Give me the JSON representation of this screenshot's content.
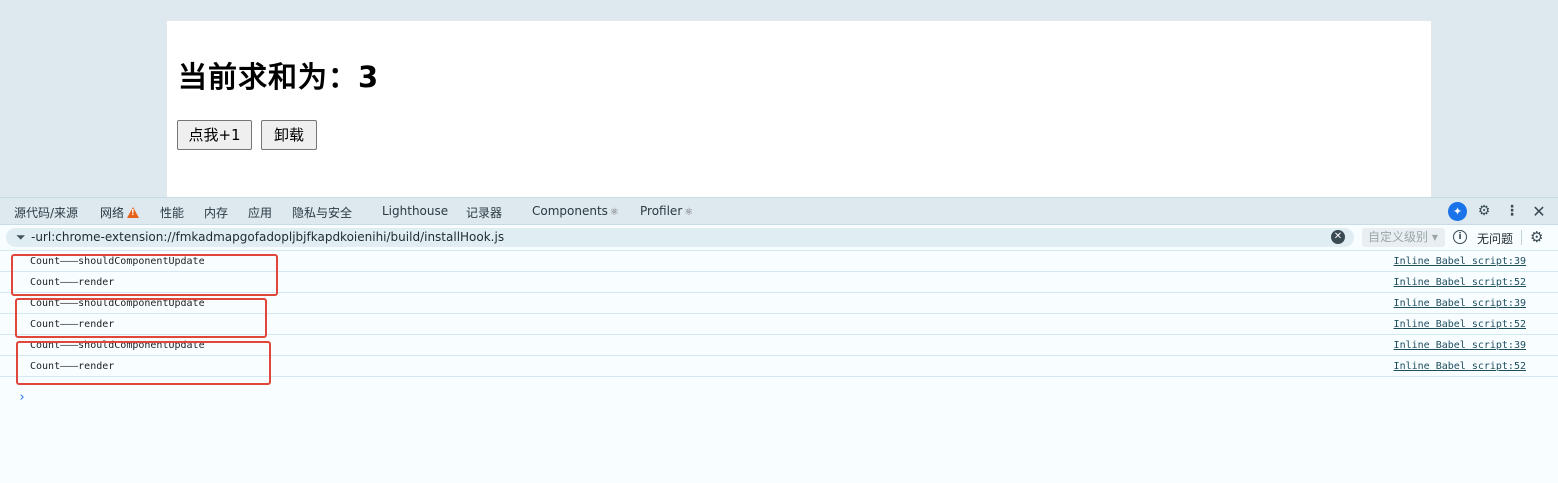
{
  "page": {
    "heading": "当前求和为：3",
    "increment_button": "点我+1",
    "unmount_button": "卸载"
  },
  "devtools": {
    "tabs": {
      "sources": "源代码/来源",
      "network": "网络",
      "performance": "性能",
      "memory": "内存",
      "application": "应用",
      "privacy": "隐私与安全",
      "lighthouse": "Lighthouse",
      "recorder": "记录器",
      "components": "Components",
      "profiler": "Profiler"
    },
    "filter": {
      "value": "-url:chrome-extension://fmkadmapgofadopljbjfkapdkoienihi/build/installHook.js",
      "level_select": "自定义级别",
      "issues": "无问题"
    },
    "console_rows": [
      {
        "message": "Count———shouldComponentUpdate",
        "source": "Inline Babel script:39"
      },
      {
        "message": "Count———render",
        "source": "Inline Babel script:52"
      },
      {
        "message": "Count———shouldComponentUpdate",
        "source": "Inline Babel script:39"
      },
      {
        "message": "Count———render",
        "source": "Inline Babel script:52"
      },
      {
        "message": "Count———shouldComponentUpdate",
        "source": "Inline Babel script:39"
      },
      {
        "message": "Count———render",
        "source": "Inline Babel script:52"
      }
    ],
    "prompt": "›"
  },
  "colors": {
    "highlight": "#e0463a",
    "accent": "#1a73e8",
    "warning": "#e8621a"
  },
  "icons": [
    "warning-icon",
    "ai-assistant-icon",
    "settings-icon",
    "more-icon",
    "close-icon",
    "filter-icon",
    "clear-icon",
    "info-icon"
  ]
}
